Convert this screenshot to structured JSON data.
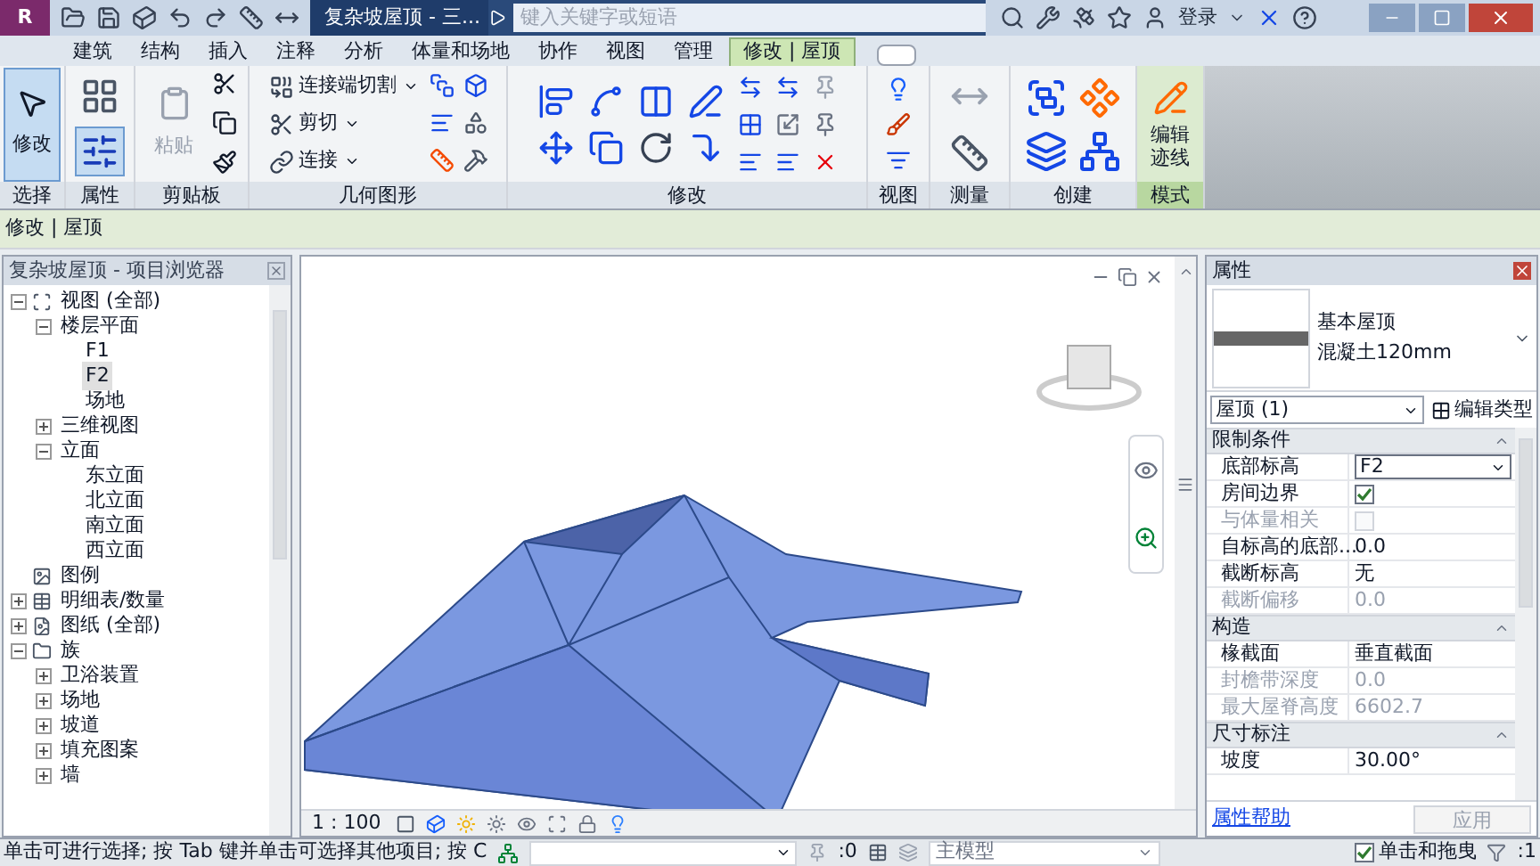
{
  "app_logo": "R",
  "window": {
    "title": "复杂坡屋顶 - 三...",
    "search": {
      "placeholder": "键入关键字或短语"
    },
    "sign_in": "登录"
  },
  "tabs": [
    {
      "label": "建筑",
      "selected": false
    },
    {
      "label": "结构",
      "selected": false
    },
    {
      "label": "插入",
      "selected": false
    },
    {
      "label": "注释",
      "selected": false
    },
    {
      "label": "分析",
      "selected": false
    },
    {
      "label": "体量和场地",
      "selected": false
    },
    {
      "label": "协作",
      "selected": false
    },
    {
      "label": "视图",
      "selected": false
    },
    {
      "label": "管理",
      "selected": false
    },
    {
      "label": "修改 | 屋顶",
      "selected": true
    }
  ],
  "ribbon": {
    "panels": [
      {
        "label": "选择",
        "kind": "select",
        "buttons": [
          {
            "label": "修改",
            "selected": true
          }
        ]
      },
      {
        "label": "属性",
        "kind": "properties"
      },
      {
        "label": "剪贴板",
        "kind": "clipboard",
        "buttons": [
          {
            "label": "粘贴",
            "disabled": true
          }
        ]
      },
      {
        "label": "几何图形",
        "kind": "geometry",
        "buttons": [
          {
            "label": "连接端切割"
          },
          {
            "label": "剪切"
          },
          {
            "label": "连接"
          }
        ]
      },
      {
        "label": "修改",
        "kind": "modify"
      },
      {
        "label": "视图",
        "kind": "view"
      },
      {
        "label": "测量",
        "kind": "measure"
      },
      {
        "label": "创建",
        "kind": "create"
      },
      {
        "label": "模式",
        "kind": "mode",
        "buttons": [
          {
            "label": "编辑迹线"
          }
        ]
      }
    ]
  },
  "options_bar": {
    "context": "修改 | 屋顶"
  },
  "project_browser": {
    "title": "复杂坡屋顶 - 项目浏览器",
    "tree": [
      {
        "label": "视图 (全部)",
        "kind": "views",
        "expanded": true,
        "selected": false,
        "children": [
          {
            "label": "楼层平面",
            "expanded": true,
            "selected": false,
            "children": [
              {
                "label": "F1",
                "selected": false
              },
              {
                "label": "F2",
                "selected": true
              },
              {
                "label": "场地",
                "selected": false
              }
            ]
          },
          {
            "label": "三维视图",
            "expanded": false,
            "selected": false
          },
          {
            "label": "立面",
            "expanded": true,
            "selected": false,
            "children": [
              {
                "label": "东立面",
                "selected": false
              },
              {
                "label": "北立面",
                "selected": false
              },
              {
                "label": "南立面",
                "selected": false
              },
              {
                "label": "西立面",
                "selected": false
              }
            ]
          }
        ]
      },
      {
        "label": "图例",
        "kind": "legend",
        "selected": false
      },
      {
        "label": "明细表/数量",
        "kind": "schedule",
        "expanded": false,
        "selected": false
      },
      {
        "label": "图纸 (全部)",
        "kind": "sheets",
        "expanded": false,
        "selected": false
      },
      {
        "label": "族",
        "kind": "families",
        "expanded": true,
        "selected": false,
        "children": [
          {
            "label": "卫浴装置",
            "expanded": false,
            "selected": false
          },
          {
            "label": "场地",
            "expanded": false,
            "selected": false
          },
          {
            "label": "坡道",
            "expanded": false,
            "selected": false
          },
          {
            "label": "填充图案",
            "expanded": false,
            "selected": false
          },
          {
            "label": "墙",
            "expanded": false,
            "selected": false
          }
        ]
      }
    ]
  },
  "view": {
    "scale": "1 : 100"
  },
  "properties": {
    "title": "属性",
    "type_name": "基本屋顶",
    "type_detail": "混凝土120mm",
    "selector": "屋顶 (1)",
    "edit_type": "编辑类型",
    "groups": [
      {
        "label": "限制条件",
        "rows": [
          {
            "label": "底部标高",
            "value": "F2",
            "kind": "dropdown",
            "disabled": false
          },
          {
            "label": "房间边界",
            "kind": "checkbox",
            "checked": true,
            "disabled": false
          },
          {
            "label": "与体量相关",
            "kind": "checkbox",
            "checked": false,
            "disabled": true
          },
          {
            "label": "自标高的底部...",
            "value": "0.0",
            "kind": "text",
            "disabled": false
          },
          {
            "label": "截断标高",
            "value": "无",
            "kind": "text",
            "disabled": false
          },
          {
            "label": "截断偏移",
            "value": "0.0",
            "kind": "text",
            "disabled": true
          }
        ]
      },
      {
        "label": "构造",
        "rows": [
          {
            "label": "椽截面",
            "value": "垂直截面",
            "kind": "text",
            "disabled": false
          },
          {
            "label": "封檐带深度",
            "value": "0.0",
            "kind": "text",
            "disabled": true
          },
          {
            "label": "最大屋脊高度",
            "value": "6602.7",
            "kind": "text",
            "disabled": true
          }
        ]
      },
      {
        "label": "尺寸标注",
        "rows": [
          {
            "label": "坡度",
            "value": "30.00°",
            "kind": "text",
            "disabled": false
          }
        ]
      }
    ],
    "help_link": "属性帮助",
    "apply": {
      "label": "应用",
      "disabled": true
    }
  },
  "status_bar": {
    "message": "单击可进行选择; 按 Tab 键并单击可选择其他项目; 按 C",
    "selection_count": ":0",
    "workset": "主模型",
    "drag": {
      "label": "单击和拖曳",
      "checked": true
    },
    "filter_count": ":1"
  }
}
